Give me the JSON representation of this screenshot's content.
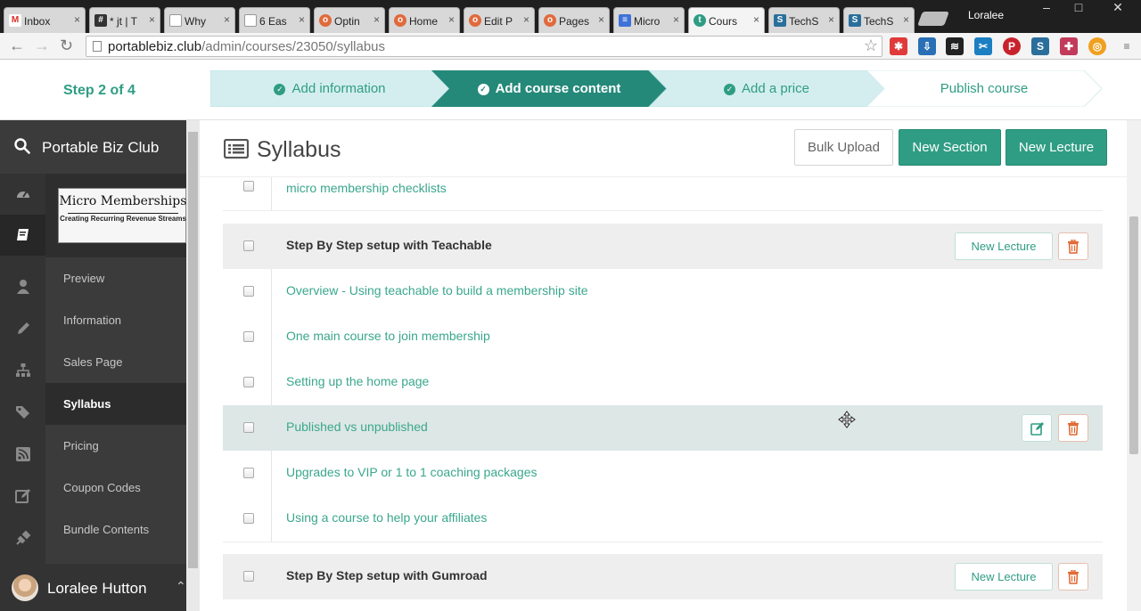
{
  "browser": {
    "tabs": [
      {
        "label": "Inbox",
        "favicon": "gmail-icon",
        "color": "#d93025",
        "glyph": "M"
      },
      {
        "label": "* jt | T",
        "favicon": "hashtag-icon",
        "color": "#444444",
        "glyph": "#"
      },
      {
        "label": "Why",
        "favicon": "page-icon",
        "color": "#cfcfcf",
        "glyph": ""
      },
      {
        "label": "6 Eas",
        "favicon": "page-icon",
        "color": "#cfcfcf",
        "glyph": ""
      },
      {
        "label": "Optin",
        "favicon": "optin-icon",
        "color": "#e06a3c",
        "glyph": "o"
      },
      {
        "label": "Home",
        "favicon": "optin-icon",
        "color": "#e06a3c",
        "glyph": "o"
      },
      {
        "label": "Edit P",
        "favicon": "optin-icon",
        "color": "#e06a3c",
        "glyph": "o"
      },
      {
        "label": "Pages",
        "favicon": "optin-icon",
        "color": "#e06a3c",
        "glyph": "o"
      },
      {
        "label": "Micro",
        "favicon": "docs-icon",
        "color": "#3f72d8",
        "glyph": "≡"
      },
      {
        "label": "Cours",
        "favicon": "teachable-icon",
        "color": "#2f9d84",
        "glyph": "t"
      },
      {
        "label": "TechS",
        "favicon": "techsmith-icon",
        "color": "#2a6f9b",
        "glyph": "S"
      },
      {
        "label": "TechS",
        "favicon": "techsmith-icon",
        "color": "#2a6f9b",
        "glyph": "S"
      }
    ],
    "profile_name": "Loralee",
    "url_host": "portablebiz.club",
    "url_path": "/admin/courses/23050/syllabus"
  },
  "wizard": {
    "step_label": "Step 2 of 4",
    "steps": [
      {
        "label": "Add information",
        "state": "done"
      },
      {
        "label": "Add course content",
        "state": "active"
      },
      {
        "label": "Add a price",
        "state": "done"
      },
      {
        "label": "Publish course",
        "state": "pending"
      }
    ]
  },
  "sidebar": {
    "school_name": "Portable Biz Club",
    "logo_title": "Micro Memberships",
    "logo_subtitle": "Creating Recurring Revenue Streams",
    "items": [
      {
        "label": "Preview",
        "icon": "user-icon"
      },
      {
        "label": "Information",
        "icon": "pencil-icon"
      },
      {
        "label": "Sales Page",
        "icon": "sitemap-icon"
      },
      {
        "label": "Syllabus",
        "icon": "tags-icon",
        "active": true
      },
      {
        "label": "Pricing",
        "icon": "rss-icon"
      },
      {
        "label": "Coupon Codes",
        "icon": "edit-icon"
      },
      {
        "label": "Bundle Contents",
        "icon": "plug-icon"
      }
    ],
    "user_name": "Loralee Hutton"
  },
  "main": {
    "title": "Syllabus",
    "bulk_upload": "Bulk Upload",
    "new_section": "New Section",
    "new_lecture": "New Lecture",
    "rows": [
      {
        "type": "lecture",
        "text": "micro membership checklists"
      },
      {
        "type": "section",
        "text": "Step By Step setup with Teachable",
        "button": "New Lecture"
      },
      {
        "type": "lecture",
        "text": "Overview - Using teachable to build a membership site"
      },
      {
        "type": "lecture",
        "text": "One main course to join membership"
      },
      {
        "type": "lecture",
        "text": "Setting up the home page"
      },
      {
        "type": "lecture",
        "text": "Published vs unpublished",
        "hover": true
      },
      {
        "type": "lecture",
        "text": "Upgrades to VIP or 1 to 1 coaching packages"
      },
      {
        "type": "lecture",
        "text": "Using a course to help your affiliates"
      },
      {
        "type": "section",
        "text": "Step By Step setup with Gumroad",
        "button": "New Lecture"
      }
    ]
  },
  "colors": {
    "accent": "#2f9d84",
    "delete": "#e0632b",
    "sidebar": "#3b3b3b"
  }
}
